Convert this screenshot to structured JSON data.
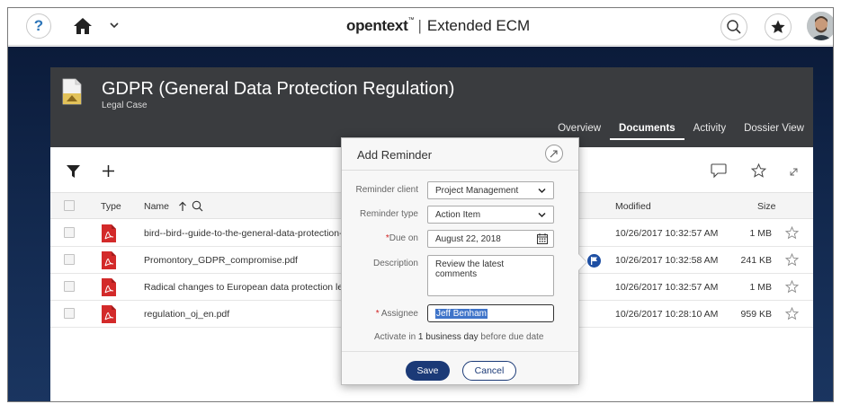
{
  "topbar": {
    "help_glyph": "?",
    "logo_brand": "opentext",
    "logo_tm": "™",
    "logo_sep": "|",
    "logo_product": "Extended ECM"
  },
  "icons": {
    "help": "help-icon",
    "home": "home-icon",
    "caret": "chevron-down-icon",
    "search": "search-icon",
    "favorites": "star-icon",
    "avatar": "avatar"
  },
  "workspace": {
    "title": "GDPR (General Data Protection Regulation)",
    "type": "Legal Case",
    "tabs": [
      "Overview",
      "Documents",
      "Activity",
      "Dossier View"
    ],
    "active_tab": "Documents"
  },
  "table": {
    "headers": {
      "type": "Type",
      "name": "Name",
      "modified": "Modified",
      "size": "Size"
    },
    "rows": [
      {
        "name": "bird--bird--guide-to-the-general-data-protection-regulation.pdf",
        "modified": "10/26/2017 10:32:57 AM",
        "size": "1 MB"
      },
      {
        "name": "Promontory_GDPR_compromise.pdf",
        "modified": "10/26/2017 10:32:58 AM",
        "size": "241 KB"
      },
      {
        "name": "Radical changes to European data protection legislation.pdf",
        "modified": "10/26/2017 10:32:57 AM",
        "size": "1 MB"
      },
      {
        "name": "regulation_oj_en.pdf",
        "modified": "10/26/2017 10:28:10 AM",
        "size": "959 KB"
      }
    ]
  },
  "dialog": {
    "title": "Add Reminder",
    "reminder_client_label": "Reminder client",
    "reminder_client_value": "Project Management",
    "reminder_type_label": "Reminder type",
    "reminder_type_value": "Action Item",
    "due_on_label": "Due on",
    "due_on_value": "August 22, 2018",
    "description_label": "Description",
    "description_value": "Review the latest comments",
    "assignee_label": "Assignee",
    "assignee_value": "Jeff Benham",
    "required_mark": "*",
    "activate_prefix": "Activate in",
    "activate_value": "1 business day",
    "activate_suffix": "before due date",
    "save_label": "Save",
    "cancel_label": "Cancel"
  },
  "colors": {
    "brand_navy": "#1b3a77",
    "header_bg": "#3a3c3f",
    "pdf_red": "#d32a2a",
    "selection": "#3f74c9"
  }
}
